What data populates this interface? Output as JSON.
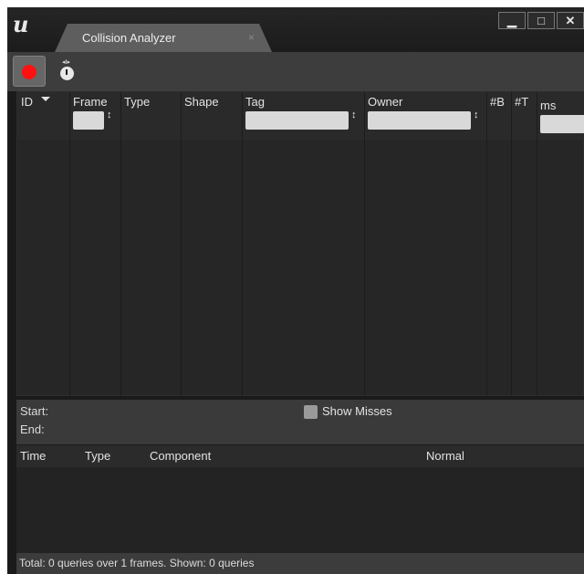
{
  "window": {
    "tab_title": "Collision Analyzer",
    "tab_close": "×",
    "minimize": "▁",
    "maximize": "□",
    "close": "✕"
  },
  "toolbar": {
    "record_icon": "record-icon",
    "timer_icon": "stopwatch-icon",
    "timer_top": "◂I▸"
  },
  "query_table": {
    "columns": [
      "ID",
      "Frame",
      "Type",
      "Shape",
      "Tag",
      "Owner",
      "#B",
      "#T",
      "ms"
    ],
    "spin_glyph": "↕",
    "rows": []
  },
  "middle": {
    "start_label": "Start:",
    "end_label": "End:",
    "show_misses": "Show Misses",
    "show_misses_checked": false
  },
  "hit_table": {
    "columns": [
      "Time",
      "Type",
      "Component",
      "Normal"
    ],
    "rows": []
  },
  "status": {
    "text": "Total: 0 queries over 1 frames. Shown: 0 queries"
  },
  "colors": {
    "record": "#ff1111",
    "background": "#1a1a1a",
    "tab": "#5e5e5e"
  }
}
